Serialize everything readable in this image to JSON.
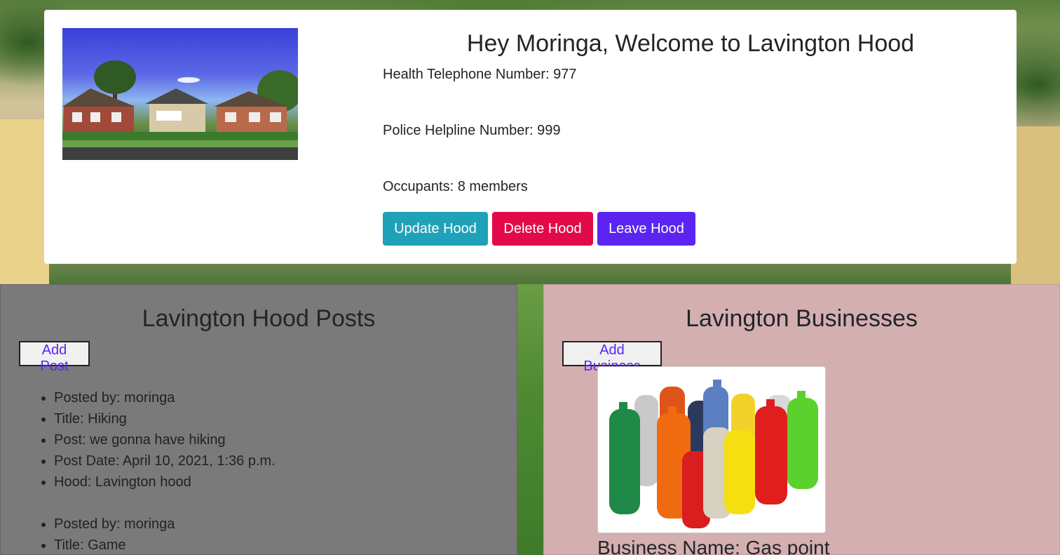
{
  "hood": {
    "welcome_title": "Hey Moringa, Welcome to Lavington Hood",
    "health_line": "Health Telephone Number: 977",
    "police_line": "Police Helpline Number: 999",
    "occupants_line": "Occupants: 8 members",
    "buttons": {
      "update": "Update Hood",
      "delete": "Delete Hood",
      "leave": "Leave Hood"
    }
  },
  "posts": {
    "title": "Lavington Hood Posts",
    "add_label": "Add Post",
    "items": [
      {
        "posted_by": "Posted by: moringa",
        "title": "Title: Hiking",
        "post": "Post: we gonna have hiking",
        "date": "Post Date: April 10, 2021, 1:36 p.m.",
        "hood": "Hood: Lavington hood"
      },
      {
        "posted_by": "Posted by: moringa",
        "title": "Title: Game"
      }
    ]
  },
  "businesses": {
    "title": "Lavington Businesses",
    "add_label": "Add Business",
    "items": [
      {
        "name": "Business Name: Gas point"
      }
    ]
  },
  "colors": {
    "update_button": "#1fa2b8",
    "delete_button": "#e20a48",
    "leave_button": "#5b24f0",
    "posts_panel": "#7a7a7a",
    "business_panel": "#d4afb0"
  }
}
